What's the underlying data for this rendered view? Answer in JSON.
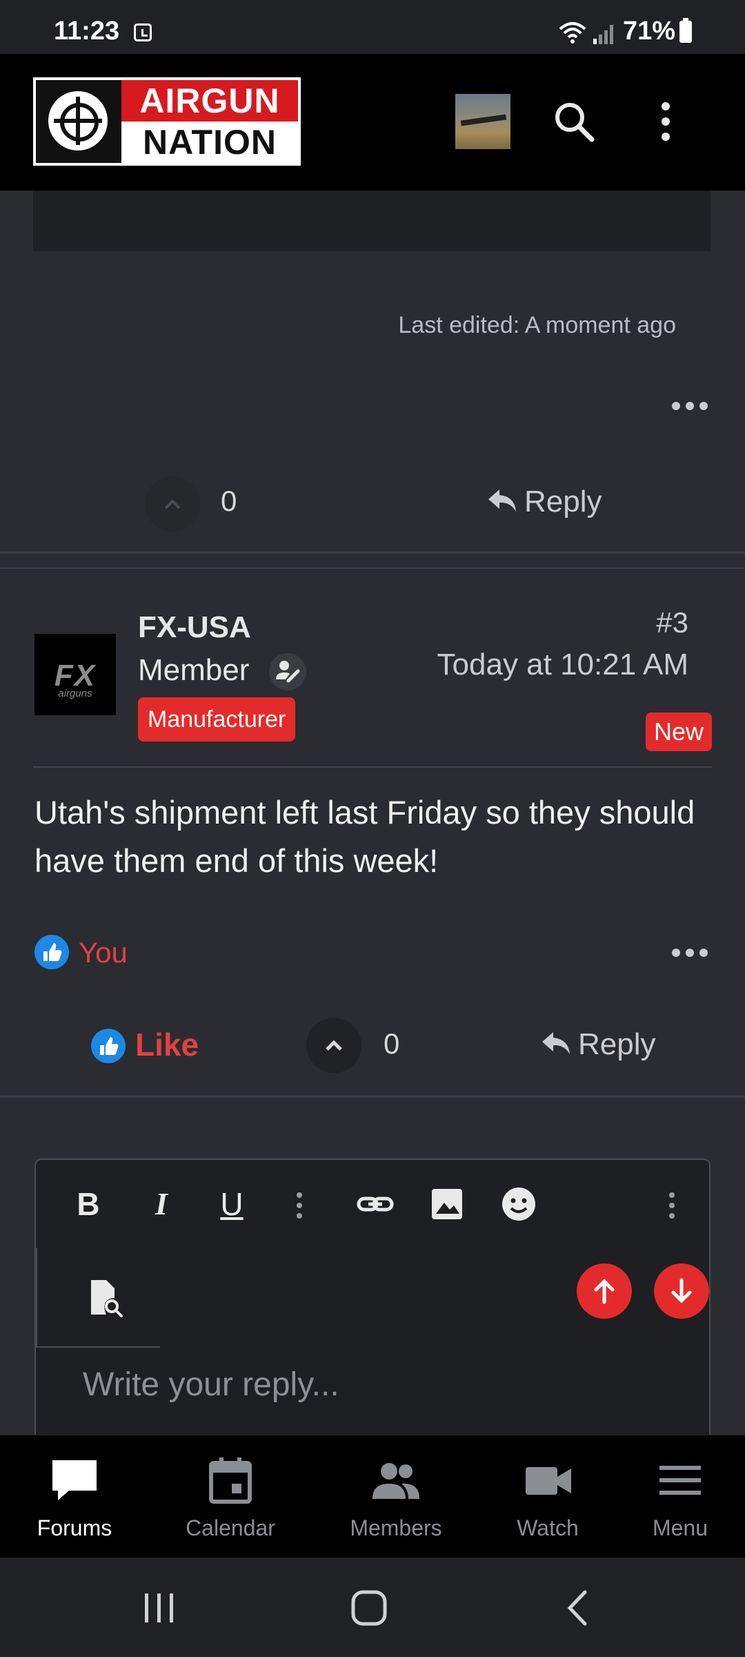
{
  "status_bar": {
    "time": "11:23",
    "battery": "71%"
  },
  "app_bar": {
    "logo_line1": "AIRGUN",
    "logo_line2": "NATION",
    "icons": [
      "user-avatar-thumbnail",
      "search-icon",
      "more-vertical-icon"
    ]
  },
  "previous_post": {
    "last_edited": "Last edited: A moment ago",
    "vote_count": "0",
    "reply_label": "Reply"
  },
  "post": {
    "username": "FX-USA",
    "role": "Member",
    "badge": "Manufacturer",
    "avatar_text": "FX",
    "avatar_subtext": "airguns",
    "number": "#3",
    "time": "Today at 10:21 AM",
    "new_badge": "New",
    "message": "Utah's shipment left last Friday so they should have them end of this week!",
    "reactions_by": "You",
    "like_label": "Like",
    "vote_count": "0",
    "reply_label": "Reply"
  },
  "editor": {
    "bold": "B",
    "italic": "I",
    "underline": "U",
    "placeholder": "Write your reply..."
  },
  "bottom_nav": {
    "items": [
      {
        "label": "Forums",
        "icon": "chat-bubble-icon",
        "active": true
      },
      {
        "label": "Calendar",
        "icon": "calendar-icon"
      },
      {
        "label": "Members",
        "icon": "people-icon"
      },
      {
        "label": "Watch",
        "icon": "video-camera-icon"
      },
      {
        "label": "Menu",
        "icon": "hamburger-icon"
      }
    ]
  },
  "colors": {
    "accent_red": "#e42b2b",
    "like_blue": "#1e88e5",
    "background": "#2a2c31"
  }
}
